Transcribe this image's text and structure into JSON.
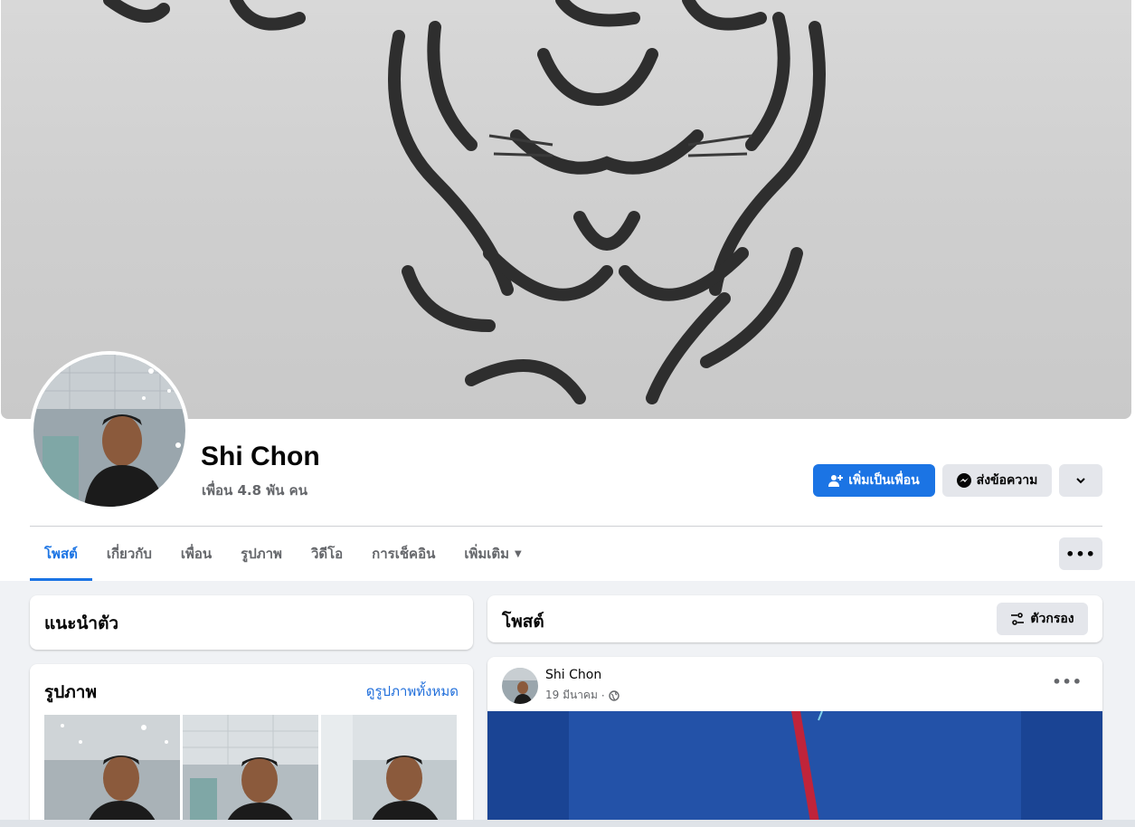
{
  "profile": {
    "name": "Shi Chon",
    "friends_count": "เพื่อน 4.8 พัน คน"
  },
  "actions": {
    "add_friend": "เพิ่มเป็นเพื่อน",
    "message": "ส่งข้อความ"
  },
  "tabs": [
    {
      "label": "โพสต์",
      "active": true
    },
    {
      "label": "เกี่ยวกับ"
    },
    {
      "label": "เพื่อน"
    },
    {
      "label": "รูปภาพ"
    },
    {
      "label": "วิดีโอ"
    },
    {
      "label": "การเช็คอิน"
    },
    {
      "label": "เพิ่มเติม"
    }
  ],
  "intro": {
    "title": "แนะนำตัว"
  },
  "photos": {
    "title": "รูปภาพ",
    "see_all": "ดูรูปภาพทั้งหมด"
  },
  "posts": {
    "title": "โพสต์",
    "filter": "ตัวกรอง"
  },
  "post": {
    "author": "Shi Chon",
    "date": "19 มีนาคม",
    "separator": "·"
  },
  "colors": {
    "accent": "#1b74e4",
    "background": "#f0f2f5",
    "muted_text": "#65676b"
  }
}
